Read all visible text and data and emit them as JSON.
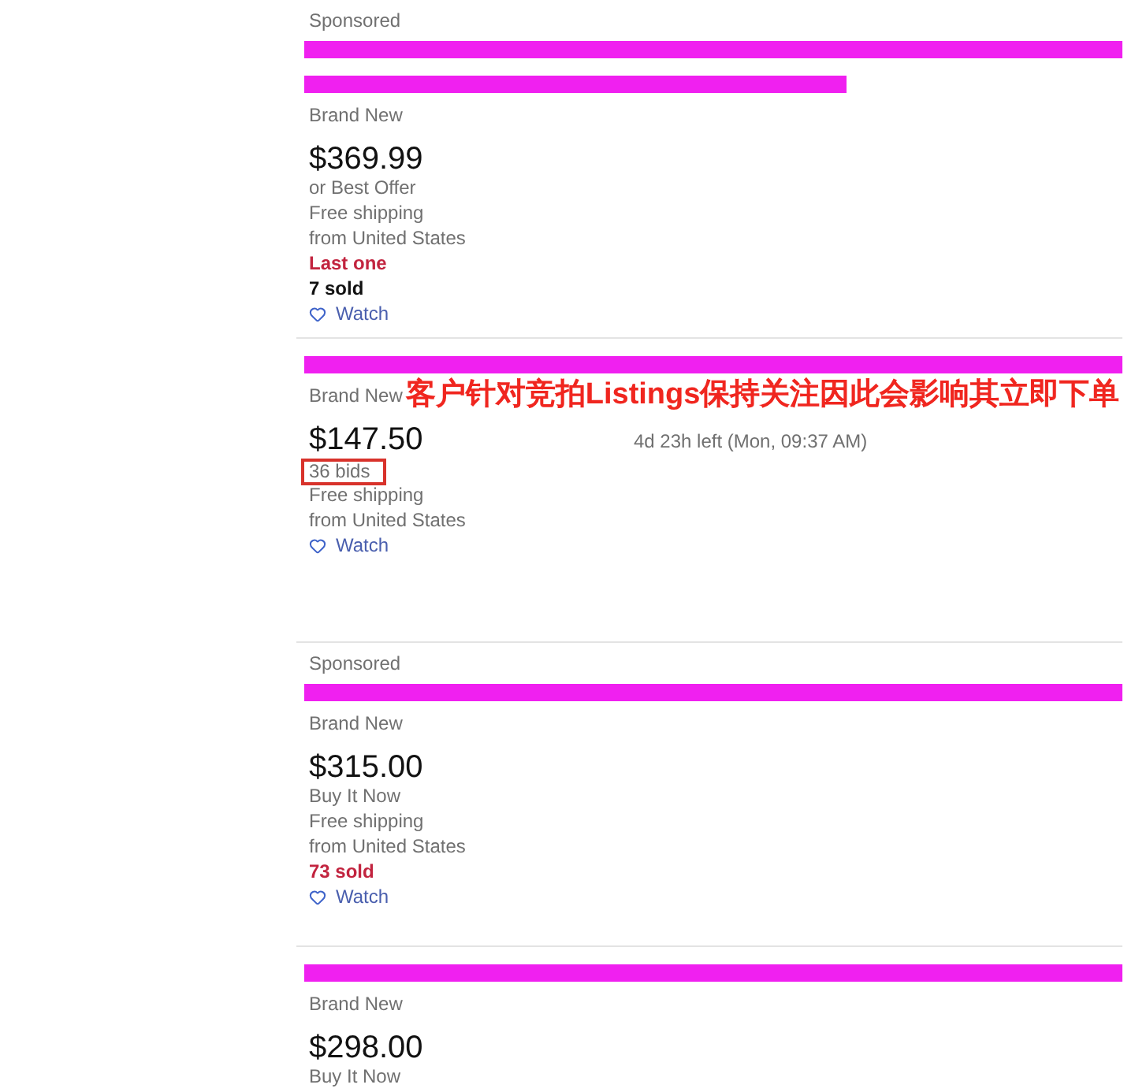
{
  "listings": [
    {
      "sponsored": "Sponsored",
      "title_bars": [
        {
          "kind": "full"
        },
        {
          "kind": "partial"
        }
      ],
      "condition": "Brand New",
      "price": "$369.99",
      "purchase_option": {
        "text": "or Best Offer",
        "highlighted": false
      },
      "shipping": "Free shipping",
      "location": "from United States",
      "badges": [
        {
          "text": "Last one",
          "kind": "alert"
        },
        {
          "text": "7 sold",
          "kind": "strong"
        }
      ],
      "watch": "Watch"
    },
    {
      "title_bars": [
        {
          "kind": "full"
        }
      ],
      "condition": "Brand New",
      "annotation": "客户针对竞拍Listings保持关注因此会影响其立即下单",
      "price": "$147.50",
      "time_left": "4d 23h left (Mon, 09:37 AM)",
      "purchase_option": {
        "text": "36 bids",
        "highlighted": true
      },
      "shipping": "Free shipping",
      "location": "from United States",
      "watch": "Watch"
    },
    {
      "sponsored": "Sponsored",
      "title_bars": [
        {
          "kind": "full"
        }
      ],
      "condition": "Brand New",
      "price": "$315.00",
      "purchase_option": {
        "text": "Buy It Now",
        "highlighted": false
      },
      "shipping": "Free shipping",
      "location": "from United States",
      "badges": [
        {
          "text": "73 sold",
          "kind": "alert"
        }
      ],
      "watch": "Watch"
    },
    {
      "title_bars": [
        {
          "kind": "full"
        }
      ],
      "condition": "Brand New",
      "price": "$298.00",
      "purchase_option": {
        "text": "Buy It Now",
        "highlighted": false
      }
    }
  ]
}
